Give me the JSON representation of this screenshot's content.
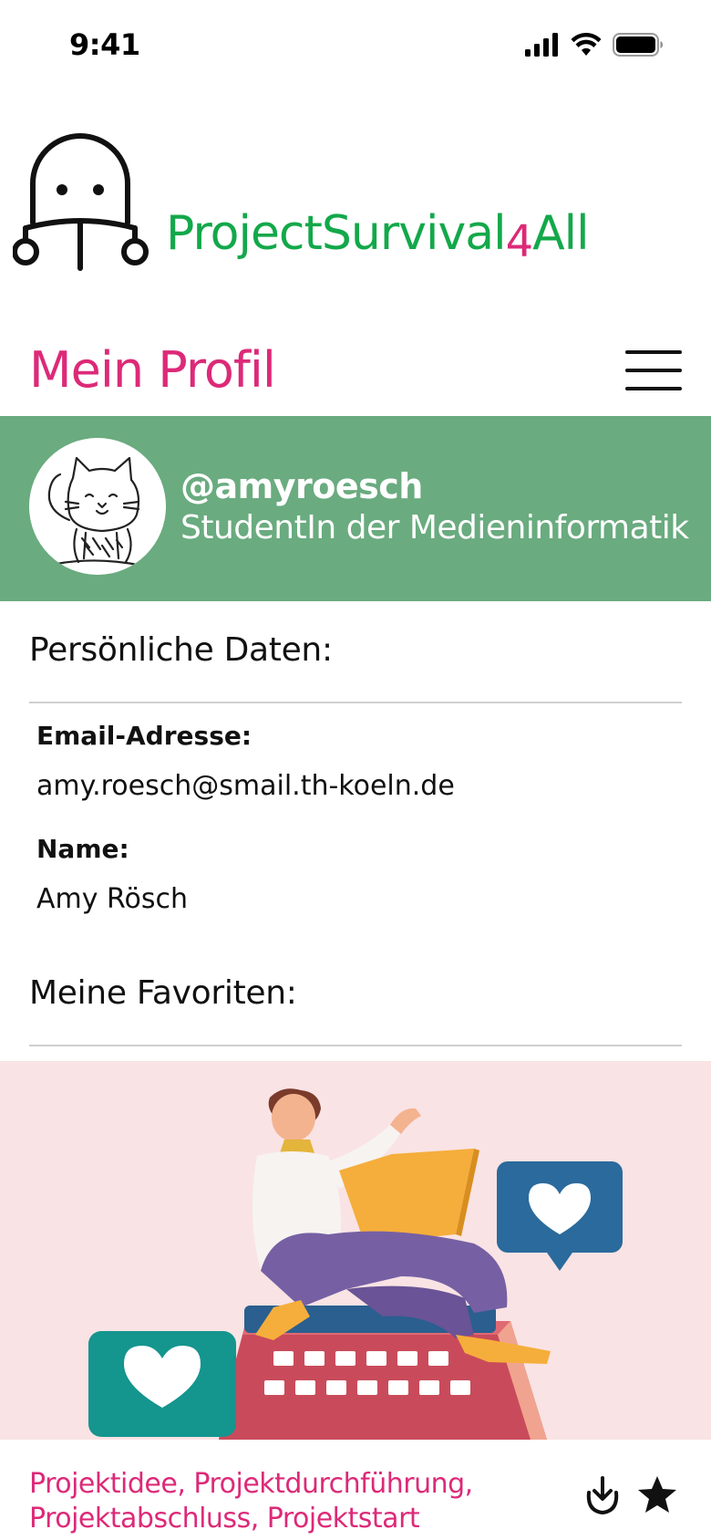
{
  "status_bar": {
    "time": "9:41"
  },
  "brand": {
    "name_part1": "ProjectSurvival",
    "name_accent": "4",
    "name_part2": "All",
    "colors": {
      "primary": "#13a84a",
      "accent": "#dc2a78"
    }
  },
  "header": {
    "title": "Mein Profil",
    "menu_icon": "hamburger-menu-icon"
  },
  "profile": {
    "handle": "@amyroesch",
    "role": "StudentIn der Medieninformatik",
    "avatar_icon": "cat-sketch-avatar",
    "band_color": "#6aab7f"
  },
  "personal_data": {
    "title": "Persönliche Daten:",
    "email_label": "Email-Adresse:",
    "email_value": "amy.roesch@smail.th-koeln.de",
    "name_label": "Name:",
    "name_value": "Amy Rösch"
  },
  "favorites": {
    "title": "Meine Favoriten:",
    "items": [
      {
        "tags": "Projektidee, Projektdurchführung, Projektabschluss, Projektstart",
        "image_icon": "person-laptop-hearts-illustration",
        "actions": [
          {
            "icon": "download-icon"
          },
          {
            "icon": "star-filled-icon"
          }
        ]
      }
    ]
  }
}
